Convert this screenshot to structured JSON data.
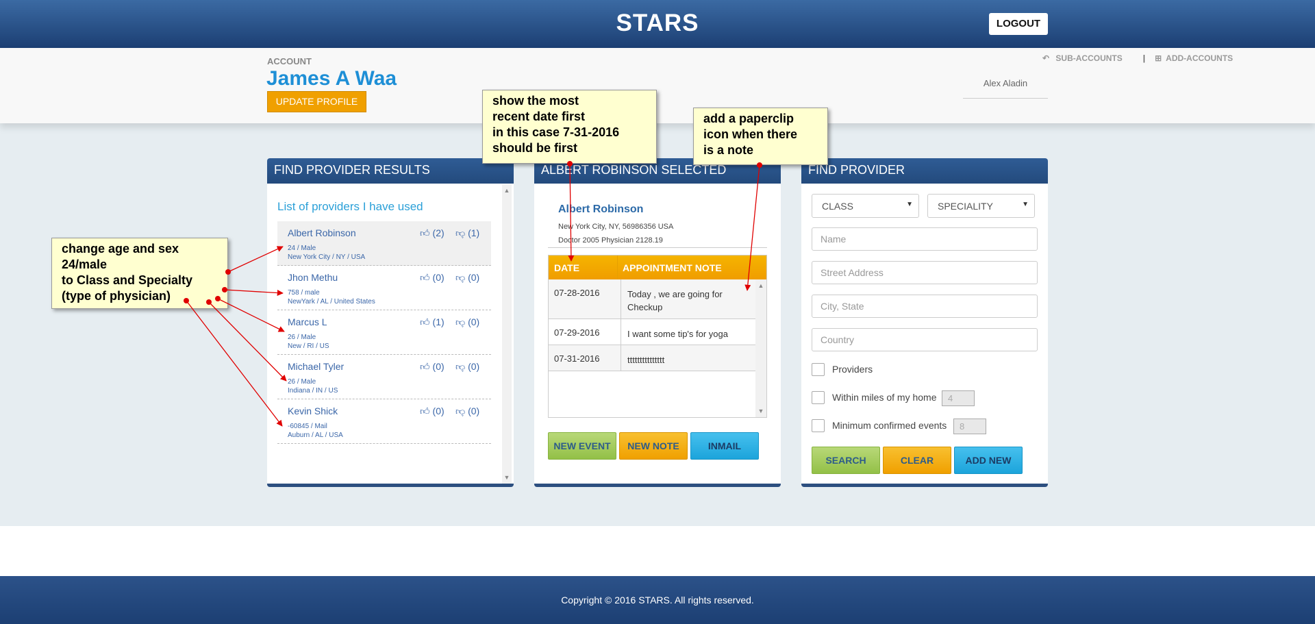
{
  "header": {
    "brand": "STARS",
    "logout": "LOGOUT"
  },
  "account": {
    "label": "ACCOUNT",
    "name": "James A Waa",
    "update_button": "UPDATE PROFILE",
    "sub_accounts": "SUB-ACCOUNTS",
    "separator": "|",
    "add_accounts": "ADD-ACCOUNTS",
    "user": "Alex Aladin"
  },
  "results": {
    "title": "FIND PROVIDER RESULTS",
    "list_title": "List of providers I have used",
    "providers": [
      {
        "name": "Albert Robinson",
        "line1": "24 / Male",
        "line2": "New York City / NY / USA",
        "up": "(2)",
        "down": "(1)"
      },
      {
        "name": "Jhon Methu",
        "line1": "758 / male",
        "line2": "NewYark / AL / United States",
        "up": "(0)",
        "down": "(0)"
      },
      {
        "name": "Marcus L",
        "line1": "26 / Male",
        "line2": "New / RI / US",
        "up": "(1)",
        "down": "(0)"
      },
      {
        "name": "Michael Tyler",
        "line1": "26 / Male",
        "line2": "Indiana / IN / US",
        "up": "(0)",
        "down": "(0)"
      },
      {
        "name": "Kevin Shick",
        "line1": "-60845 / Mail",
        "line2": "Auburn / AL / USA",
        "up": "(0)",
        "down": "(0)"
      }
    ]
  },
  "selected": {
    "title": "ALBERT ROBINSON SELECTED",
    "name": "Albert Robinson",
    "address": "New York City, NY, 56986356 USA",
    "info": "Doctor 2005 Physician 2128.19",
    "table": {
      "headers": [
        "DATE",
        "APPOINTMENT NOTE"
      ],
      "rows": [
        [
          "07-28-2016",
          "Today , we are going for Checkup"
        ],
        [
          "07-29-2016",
          "I want some tip's for yoga"
        ],
        [
          "07-31-2016",
          "ttttttttttttttt"
        ]
      ]
    },
    "buttons": {
      "new_event": "NEW EVENT",
      "new_note": "NEW NOTE",
      "inmail": "INMAIL"
    }
  },
  "find": {
    "title": "FIND PROVIDER",
    "class_select": "CLASS",
    "speciality_select": "SPECIALITY",
    "name_placeholder": "Name",
    "street_placeholder": "Street Address",
    "city_placeholder": "City, State",
    "country_placeholder": "Country",
    "providers_label": "Providers",
    "miles_label": "Within miles of my home",
    "miles_value": "4",
    "events_label": "Minimum confirmed events",
    "events_value": "8",
    "buttons": {
      "search": "SEARCH",
      "clear": "CLEAR",
      "add_new": "ADD NEW"
    }
  },
  "footer": {
    "copyright": "Copyright © 2016 STARS. All rights reserved."
  },
  "annotations": {
    "age_sex": [
      "change age and sex",
      "24/male",
      "to Class and Specialty",
      "(type of physician)"
    ],
    "recent_date": [
      "show the most",
      "recent date first",
      "in this case 7-31-2016",
      "should be first"
    ],
    "paperclip": [
      "add a paperclip",
      "icon when there",
      "is a note"
    ]
  },
  "colors": {
    "header": "#1c3f73",
    "accent": "#1e8fd6",
    "orange": "#f0a000",
    "green": "#93c047",
    "blue": "#1ca4db",
    "note_bg": "#ffffd0",
    "arrow": "#e00000"
  }
}
